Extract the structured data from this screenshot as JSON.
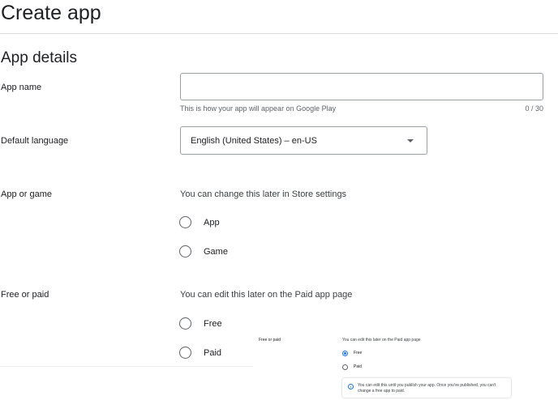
{
  "page": {
    "title": "Create app"
  },
  "app_details": {
    "section_title": "App details",
    "app_name": {
      "label": "App name",
      "value": "",
      "placeholder": "",
      "helper": "This is how your app will appear on Google Play",
      "counter": "0 / 30"
    },
    "default_language": {
      "label": "Default language",
      "selected": "English (United States) – en-US"
    },
    "app_or_game": {
      "label": "App or game",
      "hint": "You can change this later in Store settings",
      "options": [
        "App",
        "Game"
      ]
    },
    "free_or_paid": {
      "label": "Free or paid",
      "hint": "You can edit this later on the Paid app page",
      "options": [
        "Free",
        "Paid"
      ]
    }
  },
  "inset": {
    "label": "Free or paid",
    "hint": "You can edit this later on the Paid app page",
    "options": [
      {
        "label": "Free",
        "checked": true
      },
      {
        "label": "Paid",
        "checked": false
      }
    ],
    "info_icon": "info-icon",
    "info_text": "You can edit this until you publish your app. Once you've published, you can't change a free app to paid."
  },
  "colors": {
    "accent": "#1a73e8",
    "text": "#202124",
    "muted": "#5f6368",
    "border": "#9aa0a6"
  }
}
